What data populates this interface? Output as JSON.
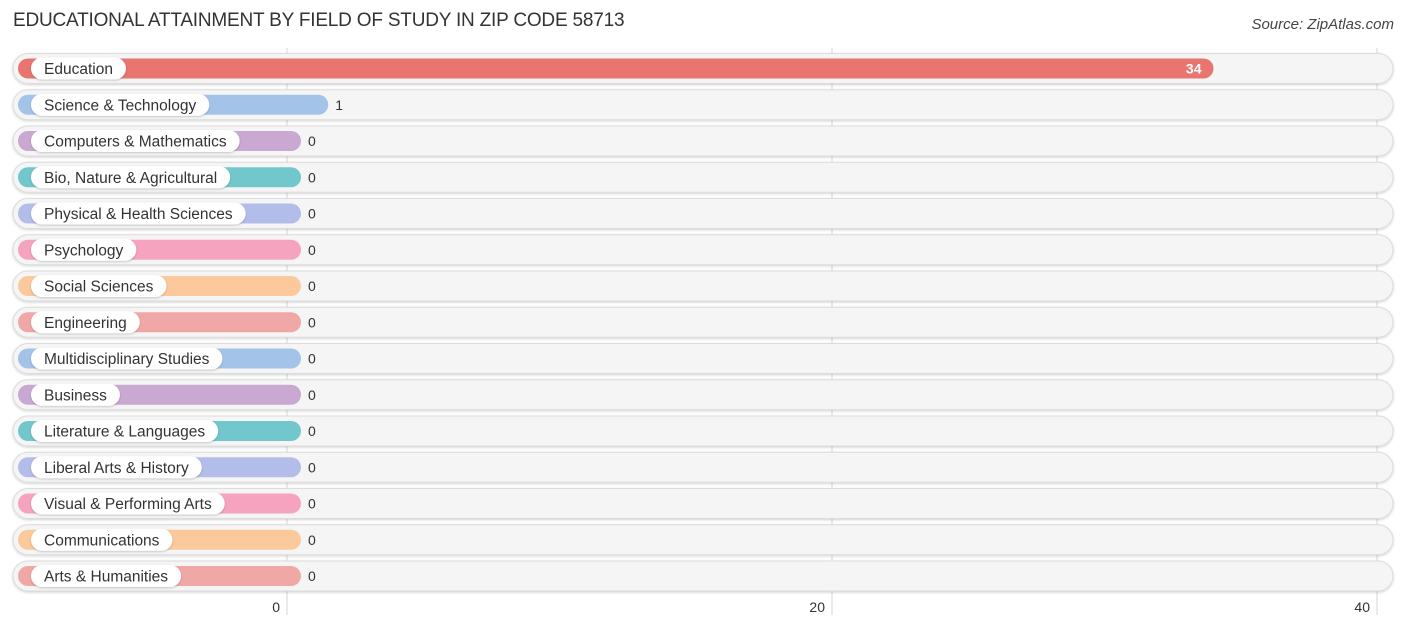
{
  "header": {
    "title": "EDUCATIONAL ATTAINMENT BY FIELD OF STUDY IN ZIP CODE 58713",
    "source": "Source: ZipAtlas.com"
  },
  "chart_data": {
    "type": "bar",
    "orientation": "horizontal",
    "title": "EDUCATIONAL ATTAINMENT BY FIELD OF STUDY IN ZIP CODE 58713",
    "xlabel": "",
    "ylabel": "",
    "xlim": [
      0,
      40
    ],
    "x_ticks": [
      0,
      20,
      40
    ],
    "x_tick_labels": [
      "0",
      "20",
      "40"
    ],
    "grid": true,
    "categories": [
      "Education",
      "Science & Technology",
      "Computers & Mathematics",
      "Bio, Nature & Agricultural",
      "Physical & Health Sciences",
      "Psychology",
      "Social Sciences",
      "Engineering",
      "Multidisciplinary Studies",
      "Business",
      "Literature & Languages",
      "Liberal Arts & History",
      "Visual & Performing Arts",
      "Communications",
      "Arts & Humanities"
    ],
    "values": [
      34,
      1,
      0,
      0,
      0,
      0,
      0,
      0,
      0,
      0,
      0,
      0,
      0,
      0,
      0
    ],
    "value_labels": [
      "34",
      "1",
      "0",
      "0",
      "0",
      "0",
      "0",
      "0",
      "0",
      "0",
      "0",
      "0",
      "0",
      "0",
      "0"
    ],
    "colors": [
      "#e8756f",
      "#a4c3e8",
      "#c9a8d2",
      "#72c7cc",
      "#b3bde9",
      "#f5a3bf",
      "#fbc99b",
      "#f0a8a6",
      "#a4c3e8",
      "#c9a8d2",
      "#72c7cc",
      "#b3bde9",
      "#f5a3bf",
      "#fbc99b",
      "#f0a8a6"
    ],
    "track_color": "#f5f5f5",
    "source": "Source: ZipAtlas.com"
  }
}
